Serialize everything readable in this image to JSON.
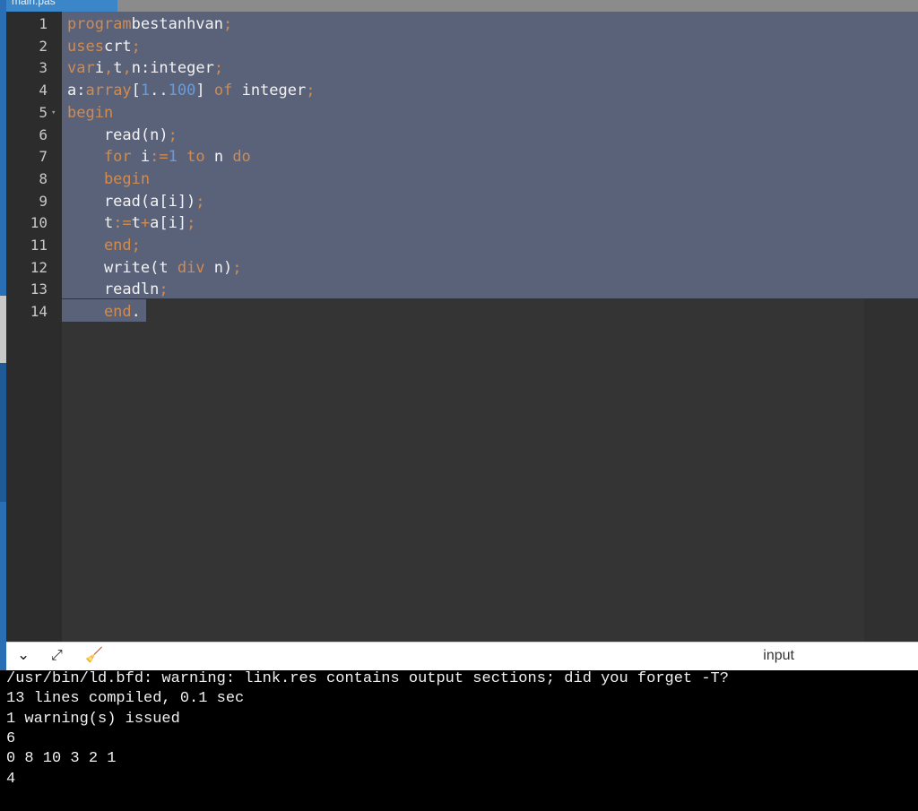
{
  "tab": {
    "label": "main.pas"
  },
  "editor": {
    "lines": [
      {
        "n": "1",
        "tokens": [
          [
            "kw",
            "program"
          ],
          [
            "",
            "bestanhvan"
          ],
          [
            "op",
            ";"
          ]
        ]
      },
      {
        "n": "2",
        "tokens": [
          [
            "kw",
            "uses"
          ],
          [
            "",
            "crt"
          ],
          [
            "op",
            ";"
          ]
        ]
      },
      {
        "n": "3",
        "tokens": [
          [
            "kw",
            "var"
          ],
          [
            "",
            "i"
          ],
          [
            "op",
            ","
          ],
          [
            "",
            "t"
          ],
          [
            "op",
            ","
          ],
          [
            "",
            "n:integer"
          ],
          [
            "op",
            ";"
          ]
        ]
      },
      {
        "n": "4",
        "tokens": [
          [
            "",
            "a:"
          ],
          [
            "kw",
            "array"
          ],
          [
            "",
            "["
          ],
          [
            "num",
            "1"
          ],
          [
            "",
            ".."
          ],
          [
            "num",
            "100"
          ],
          [
            "",
            "] "
          ],
          [
            "kw",
            "of"
          ],
          [
            "",
            " integer"
          ],
          [
            "op",
            ";"
          ]
        ]
      },
      {
        "n": "5",
        "tokens": [
          [
            "kw",
            "begin"
          ]
        ],
        "fold": true
      },
      {
        "n": "6",
        "tokens": [
          [
            "",
            "    read(n)"
          ],
          [
            "op",
            ";"
          ]
        ]
      },
      {
        "n": "7",
        "tokens": [
          [
            "kw",
            "    for"
          ],
          [
            "",
            " i"
          ],
          [
            "op",
            ":="
          ],
          [
            "num",
            "1"
          ],
          [
            "kw",
            " to"
          ],
          [
            "",
            " n "
          ],
          [
            "kw",
            "do"
          ]
        ]
      },
      {
        "n": "8",
        "tokens": [
          [
            "kw",
            "    begin"
          ]
        ]
      },
      {
        "n": "9",
        "tokens": [
          [
            "",
            "    read(a[i])"
          ],
          [
            "op",
            ";"
          ]
        ]
      },
      {
        "n": "10",
        "tokens": [
          [
            "",
            "    t"
          ],
          [
            "op",
            ":="
          ],
          [
            "",
            "t"
          ],
          [
            "op",
            "+"
          ],
          [
            "",
            "a[i]"
          ],
          [
            "op",
            ";"
          ]
        ]
      },
      {
        "n": "11",
        "tokens": [
          [
            "kw",
            "    end"
          ],
          [
            "op",
            ";"
          ]
        ]
      },
      {
        "n": "12",
        "tokens": [
          [
            "",
            "    write(t "
          ],
          [
            "kw",
            "div"
          ],
          [
            "",
            " n)"
          ],
          [
            "op",
            ";"
          ]
        ]
      },
      {
        "n": "13",
        "tokens": [
          [
            "",
            "    readln"
          ],
          [
            "op",
            ";"
          ]
        ]
      },
      {
        "n": "14",
        "tokens": [
          [
            "kw",
            "    end"
          ],
          [
            "",
            "."
          ]
        ]
      }
    ]
  },
  "console_toolbar": {
    "collapse_icon": "chevron-down-icon",
    "expand_icon": "expand-icon",
    "clear_icon": "clear-icon",
    "input_label": "input"
  },
  "console": {
    "lines": [
      "/usr/bin/ld.bfd: warning: link.res contains output sections; did you forget -T?",
      "13 lines compiled, 0.1 sec",
      "1 warning(s) issued",
      "6",
      "0 8 10 3 2 1",
      "4"
    ]
  }
}
